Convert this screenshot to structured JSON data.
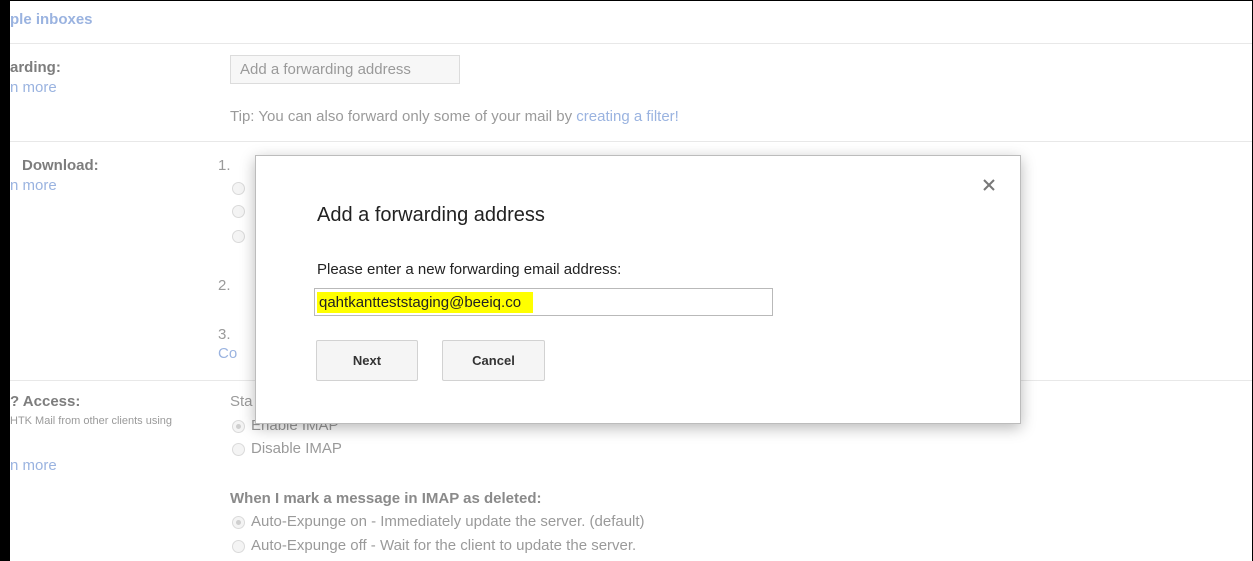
{
  "background": {
    "multiple_inboxes": "ple inboxes",
    "forwarding": {
      "label": "arding:",
      "learn_more": "n more",
      "button": "Add a forwarding address",
      "tip_prefix": "Tip: You can also forward only some of your mail by ",
      "tip_link": "creating a filter!"
    },
    "pop": {
      "label": "Download:",
      "learn_more": "n more",
      "step1": "1.",
      "step2": "2.",
      "step3": "3.",
      "config_link": "Co"
    },
    "imap": {
      "label": "Access:",
      "label_prefix": "?",
      "sub": "HTK Mail from other clients using",
      "learn_more": "n more",
      "status_prefix": "Sta",
      "enable_label": "Enable IMAP",
      "disable_label": "Disable IMAP",
      "deleted_heading": "When I mark a message in IMAP as deleted:",
      "expunge_on": "Auto-Expunge on - Immediately update the server. (default)",
      "expunge_off": "Auto-Expunge off - Wait for the client to update the server."
    }
  },
  "dialog": {
    "title": "Add a forwarding address",
    "prompt": "Please enter a new forwarding email address:",
    "input_value": "qahtkantteststaging@beeiq.co",
    "next_label": "Next",
    "cancel_label": "Cancel",
    "close_symbol": "×",
    "highlight_color": "#ffff00"
  }
}
